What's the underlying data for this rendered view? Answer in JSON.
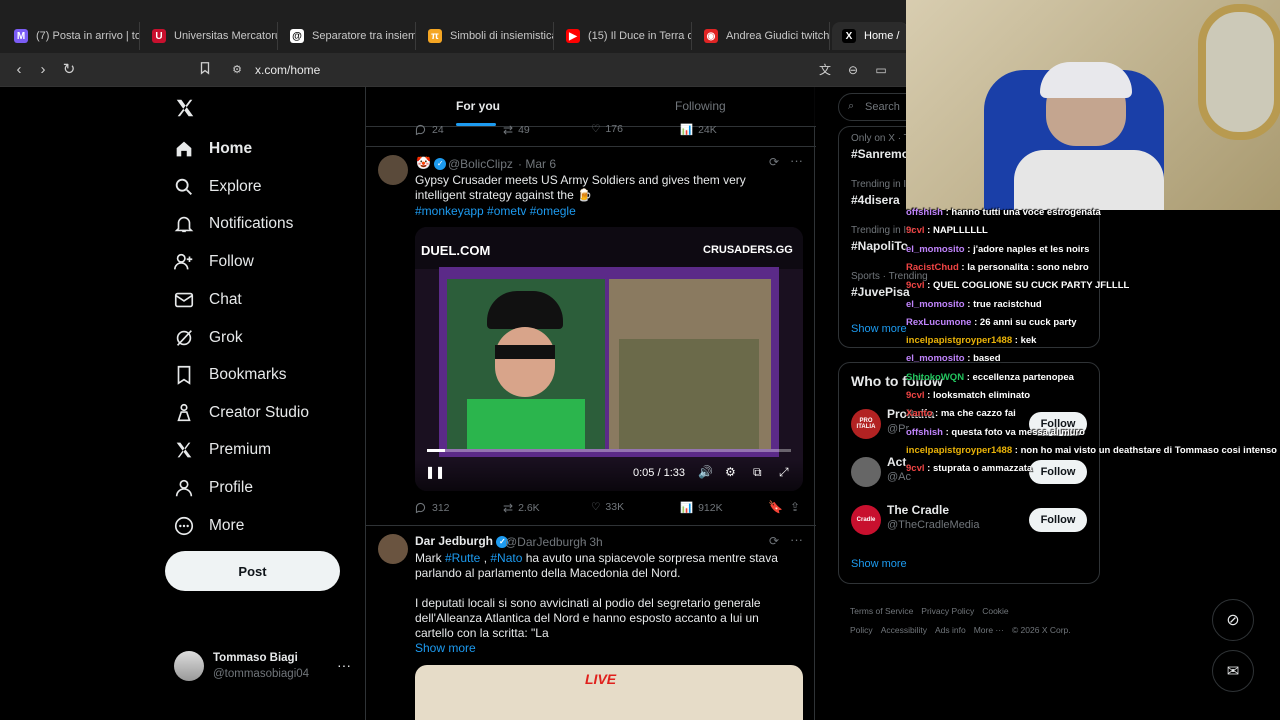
{
  "browser": {
    "tabs": [
      {
        "label": "(7) Posta in arrivo | to",
        "icon_color": "#7b5cf5",
        "glyph": "M"
      },
      {
        "label": "Universitas Mercatoru",
        "icon_color": "#c8102e",
        "glyph": "U"
      },
      {
        "label": "Separatore tra insiemi",
        "icon_color": "#ffffff",
        "glyph": "@"
      },
      {
        "label": "Simboli di insiemistica",
        "icon_color": "#f5a623",
        "glyph": "π"
      },
      {
        "label": "(15) Il Duce in Terra d",
        "icon_color": "#ff0000",
        "glyph": "▶"
      },
      {
        "label": "Andrea Giudici twitch",
        "icon_color": "#e02424",
        "glyph": "◉"
      },
      {
        "label": "Home /",
        "icon_color": "#000000",
        "glyph": "X"
      }
    ],
    "url": "x.com/home"
  },
  "nav": {
    "items": [
      {
        "label": "Home",
        "icon": "home-icon"
      },
      {
        "label": "Explore",
        "icon": "search-icon"
      },
      {
        "label": "Notifications",
        "icon": "bell-icon"
      },
      {
        "label": "Follow",
        "icon": "add-person-icon"
      },
      {
        "label": "Chat",
        "icon": "mail-icon"
      },
      {
        "label": "Grok",
        "icon": "grok-icon"
      },
      {
        "label": "Bookmarks",
        "icon": "bookmark-icon"
      },
      {
        "label": "Creator Studio",
        "icon": "creator-icon"
      },
      {
        "label": "Premium",
        "icon": "x-icon"
      },
      {
        "label": "Profile",
        "icon": "person-icon"
      },
      {
        "label": "More",
        "icon": "more-circle-icon"
      }
    ],
    "post_label": "Post",
    "account": {
      "name": "Tommaso Biagi",
      "handle": "@tommasobiagi04"
    }
  },
  "feed": {
    "tab_for_you": "For you",
    "tab_following": "Following",
    "prev_actions": {
      "replies": "24",
      "reposts": "49",
      "likes": "176",
      "views": "24K"
    },
    "tweet1": {
      "author": "@BolicClipz",
      "time": "· Mar 6",
      "text": "Gypsy Crusader meets US Army Soldiers and gives them very intelligent strategy against the 🍺",
      "hashtags": "#monkeyapp #ometv #omegle",
      "video_left_label": "DUEL.COM",
      "video_right_label": "CRUSADERS.GG",
      "video_time": "0:05 / 1:33",
      "video_progress": 0.05,
      "replies": "312",
      "reposts": "2.6K",
      "likes": "33K",
      "views": "912K"
    },
    "tweet2": {
      "name": "Dar Jedburgh",
      "handle": "@DarJedburgh",
      "time": "· 3h",
      "line1_pre": "Mark ",
      "line1_tag1": "#Rutte",
      "line1_mid": " , ",
      "line1_tag2": "#Nato",
      "line1_post": " ha avuto una spiacevole sorpresa mentre stava parlando al parlamento della Macedonia del Nord.",
      "para2": "I deputati locali si sono avvicinati al podio del segretario generale dell'Alleanza Atlantica del Nord e hanno esposto accanto a lui un cartello con la scritta: \"La",
      "show_more": "Show more",
      "media_label": "LIVE"
    }
  },
  "sidebar": {
    "search_placeholder": "Search",
    "trends": [
      {
        "context": "Only on X · T",
        "name": "#Sanremo"
      },
      {
        "context": "Trending in It",
        "name": "#4disera"
      },
      {
        "context": "Trending in Ita",
        "name": "#NapoliTo"
      },
      {
        "context": "Sports · Trending",
        "name": "#JuvePisa"
      }
    ],
    "show_more": "Show more",
    "who_to_follow": "Who to follow",
    "suggestions": [
      {
        "name": "ProItalia",
        "handle": "@Pr",
        "follow": "Follow",
        "avatar_color": "#b22222",
        "avatar_text": "PRO ITALIA"
      },
      {
        "name": "Act",
        "handle": "@Ac",
        "follow": "Follow",
        "avatar_color": "#666666",
        "avatar_text": ""
      },
      {
        "name": "The Cradle",
        "handle": "@TheCradleMedia",
        "follow": "Follow",
        "avatar_color": "#c8102e",
        "avatar_text": "Cradle"
      }
    ],
    "show_more_2": "Show more",
    "footer": [
      "Terms of Service",
      "Privacy Policy",
      "Cookie Policy",
      "Accessibility",
      "Ads info",
      "More ···",
      "© 2026 X Corp."
    ]
  },
  "chat": [
    {
      "user": "offshish",
      "color": "#c084fc",
      "msg": "hanno tutti una voce estrogenata"
    },
    {
      "user": "9cvl",
      "color": "#ef4444",
      "msg": "NAPLLLLLL"
    },
    {
      "user": "el_momosito",
      "color": "#c084fc",
      "msg": "j'adore naples et les noirs"
    },
    {
      "user": "RacistChud",
      "color": "#ef4444",
      "msg": "la personalita : sono nebro"
    },
    {
      "user": "9cvl",
      "color": "#ef4444",
      "msg": "QUEL COGLIONE SU CUCK PARTY JFLLLL"
    },
    {
      "user": "el_momosito",
      "color": "#c084fc",
      "msg": "true racistchud"
    },
    {
      "user": "RexLucumone",
      "color": "#c084fc",
      "msg": "26 anni su cuck party"
    },
    {
      "user": "incelpapistgroyper1488",
      "color": "#eab308",
      "msg": "kek"
    },
    {
      "user": "el_momosito",
      "color": "#c084fc",
      "msg": "based"
    },
    {
      "user": "ShitokoWQN",
      "color": "#22c55e",
      "msg": "eccellenza partenopea"
    },
    {
      "user": "9cvl",
      "color": "#ef4444",
      "msg": "looksmatch eliminato"
    },
    {
      "user": "Xanto",
      "color": "#ef4444",
      "msg": "ma che cazzo fai"
    },
    {
      "user": "offshish",
      "color": "#c084fc",
      "msg": "questa foto va messa al muro"
    },
    {
      "user": "incelpapistgroyper1488",
      "color": "#eab308",
      "msg": "non ho mai visto un deathstare di Tommaso cosi intenso in vita mia"
    },
    {
      "user": "9cvl",
      "color": "#ef4444",
      "msg": "stuprata o ammazzata"
    }
  ],
  "colors": {
    "accent": "#1d9bf0",
    "bg": "#000000",
    "border": "#2f3336",
    "muted": "#71767b"
  }
}
